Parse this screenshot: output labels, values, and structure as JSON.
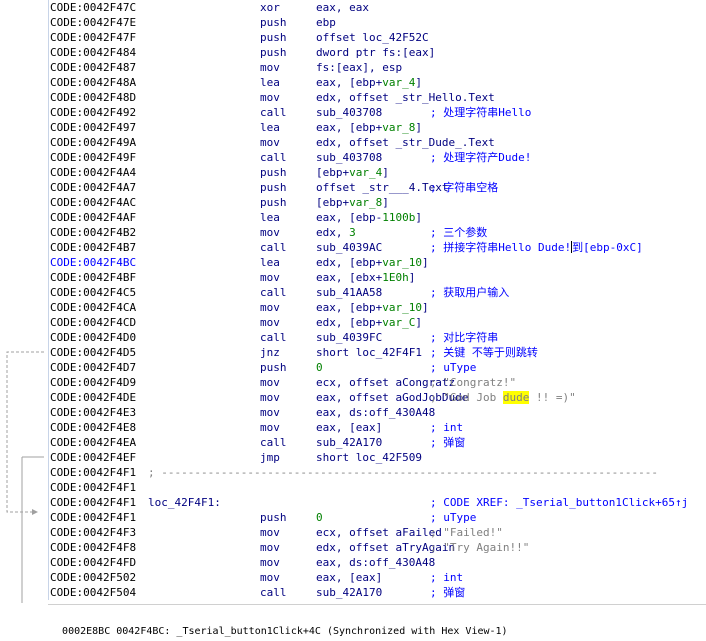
{
  "disassembly": {
    "lines": [
      {
        "addr": "CODE:0042F47C",
        "mn": "xor",
        "op": "eax, eax",
        "cmt": ""
      },
      {
        "addr": "CODE:0042F47E",
        "mn": "push",
        "op": "ebp",
        "cmt": ""
      },
      {
        "addr": "CODE:0042F47F",
        "mn": "push",
        "op": "offset loc_42F52C",
        "cmt": ""
      },
      {
        "addr": "CODE:0042F484",
        "mn": "push",
        "op": "dword ptr fs:[eax]",
        "cmt": ""
      },
      {
        "addr": "CODE:0042F487",
        "mn": "mov",
        "op": "fs:[eax], esp",
        "cmt": ""
      },
      {
        "addr": "CODE:0042F48A",
        "mn": "lea",
        "op": "eax, [ebp+var_4]",
        "cmt": ""
      },
      {
        "addr": "CODE:0042F48D",
        "mn": "mov",
        "op": "edx, offset _str_Hello.Text",
        "cmt": ""
      },
      {
        "addr": "CODE:0042F492",
        "mn": "call",
        "op": "sub_403708",
        "cmt": "; 处理字符串Hello"
      },
      {
        "addr": "CODE:0042F497",
        "mn": "lea",
        "op": "eax, [ebp+var_8]",
        "cmt": ""
      },
      {
        "addr": "CODE:0042F49A",
        "mn": "mov",
        "op": "edx, offset _str_Dude_.Text",
        "cmt": ""
      },
      {
        "addr": "CODE:0042F49F",
        "mn": "call",
        "op": "sub_403708",
        "cmt": "; 处理字符产Dude!"
      },
      {
        "addr": "CODE:0042F4A4",
        "mn": "push",
        "op": "[ebp+var_4]",
        "cmt": ""
      },
      {
        "addr": "CODE:0042F4A7",
        "mn": "push",
        "op": "offset _str___4.Text",
        "cmt": "; 字符串空格"
      },
      {
        "addr": "CODE:0042F4AC",
        "mn": "push",
        "op": "[ebp+var_8]",
        "cmt": ""
      },
      {
        "addr": "CODE:0042F4AF",
        "mn": "lea",
        "op": "eax, [ebp-1100b]",
        "cmt": ""
      },
      {
        "addr": "CODE:0042F4B2",
        "mn": "mov",
        "op": "edx, 3",
        "cmt": "; 三个参数"
      },
      {
        "addr": "CODE:0042F4B7",
        "mn": "call",
        "op": "sub_4039AC",
        "cmt": "; 拼接字符串Hello Dude!到[ebp-0xC]"
      },
      {
        "addr": "CODE:0042F4BC",
        "mn": "lea",
        "op": "edx, [ebp+var_10]",
        "cmt": ""
      },
      {
        "addr": "CODE:0042F4BF",
        "mn": "mov",
        "op": "eax, [ebx+1E0h]",
        "cmt": ""
      },
      {
        "addr": "CODE:0042F4C5",
        "mn": "call",
        "op": "sub_41AA58",
        "cmt": "; 获取用户输入"
      },
      {
        "addr": "CODE:0042F4CA",
        "mn": "mov",
        "op": "eax, [ebp+var_10]",
        "cmt": ""
      },
      {
        "addr": "CODE:0042F4CD",
        "mn": "mov",
        "op": "edx, [ebp+var_C]",
        "cmt": ""
      },
      {
        "addr": "CODE:0042F4D0",
        "mn": "call",
        "op": "sub_4039FC",
        "cmt": "; 对比字符串"
      },
      {
        "addr": "CODE:0042F4D5",
        "mn": "jnz",
        "op": "short loc_42F4F1",
        "cmt": "; 关键 不等于则跳转"
      },
      {
        "addr": "CODE:0042F4D7",
        "mn": "push",
        "op": "0",
        "cmt": "; uType"
      },
      {
        "addr": "CODE:0042F4D9",
        "mn": "mov",
        "op": "ecx, offset aCongratz",
        "cmt": "; \"Congratz!\""
      },
      {
        "addr": "CODE:0042F4DE",
        "mn": "mov",
        "op": "eax, offset aGodJobDude",
        "cmt": "; \"God Job dude !! =)\""
      },
      {
        "addr": "CODE:0042F4E3",
        "mn": "mov",
        "op": "eax, ds:off_430A48",
        "cmt": ""
      },
      {
        "addr": "CODE:0042F4E8",
        "mn": "mov",
        "op": "eax, [eax]",
        "cmt": "; int"
      },
      {
        "addr": "CODE:0042F4EA",
        "mn": "call",
        "op": "sub_42A170",
        "cmt": "; 弹窗"
      },
      {
        "addr": "CODE:0042F4EF",
        "mn": "jmp",
        "op": "short loc_42F509",
        "cmt": ""
      },
      {
        "addr": "CODE:0042F4F1",
        "sep": "; ---------------------------------------------------------------------------"
      },
      {
        "addr": "CODE:0042F4F1"
      },
      {
        "addr": "CODE:0042F4F1",
        "label": "loc_42F4F1:",
        "cmt": "; CODE XREF: _Tserial_button1Click+65↑j"
      },
      {
        "addr": "CODE:0042F4F1",
        "mn": "push",
        "op": "0",
        "cmt": "; uType"
      },
      {
        "addr": "CODE:0042F4F3",
        "mn": "mov",
        "op": "ecx, offset aFailed",
        "cmt": "; \"Failed!\""
      },
      {
        "addr": "CODE:0042F4F8",
        "mn": "mov",
        "op": "edx, offset aTryAgain",
        "cmt": "; \"Try Again!!\""
      },
      {
        "addr": "CODE:0042F4FD",
        "mn": "mov",
        "op": "eax, ds:off_430A48",
        "cmt": ""
      },
      {
        "addr": "CODE:0042F502",
        "mn": "mov",
        "op": "eax, [eax]",
        "cmt": "; int"
      },
      {
        "addr": "CODE:0042F504",
        "mn": "call",
        "op": "sub_42A170",
        "cmt": "; 弹窗"
      }
    ]
  },
  "statusbar": {
    "text": "0002E8BC 0042F4BC: _Tserial_button1Click+4C (Synchronized with Hex View-1)"
  },
  "colors": {
    "address": "#000000",
    "address_highlight": "#0000ff",
    "instruction": "#000080",
    "comment": "#0000ff",
    "number_or_var": "#008000",
    "string_comment": "#808080",
    "search_highlight": "#ffff00",
    "flow_arrow": "#a0a0a0"
  }
}
